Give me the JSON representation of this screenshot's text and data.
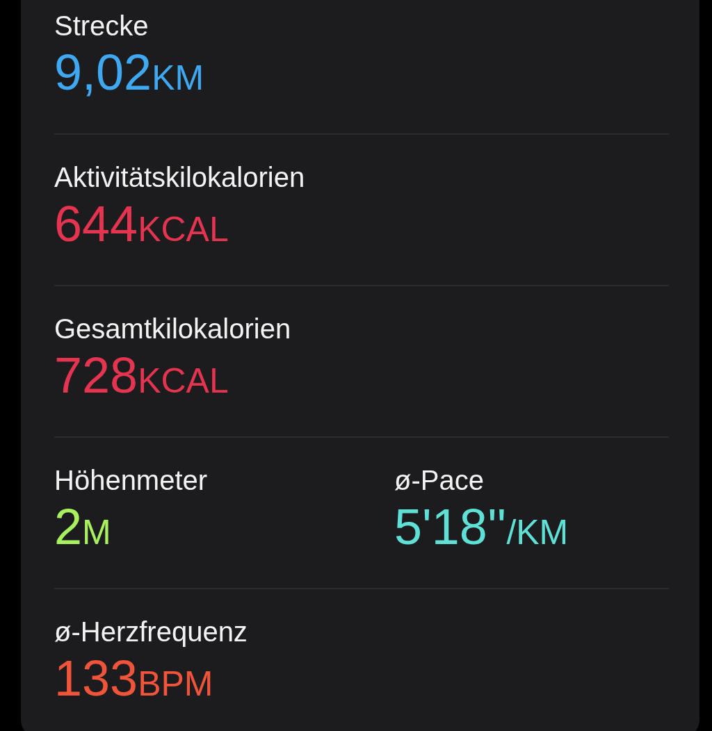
{
  "rows": [
    {
      "metrics": [
        {
          "label": "Strecke",
          "value": "9,02",
          "unit": "KM",
          "color": "#3fa8f2"
        }
      ]
    },
    {
      "metrics": [
        {
          "label": "Aktivitätskilokalorien",
          "value": "644",
          "unit": "KCAL",
          "color": "#e5344f"
        }
      ]
    },
    {
      "metrics": [
        {
          "label": "Gesamtkilokalorien",
          "value": "728",
          "unit": "KCAL",
          "color": "#e5344f"
        }
      ]
    },
    {
      "metrics": [
        {
          "label": "Höhenmeter",
          "value": "2",
          "unit": "M",
          "color": "#a8f05e"
        },
        {
          "label": "ø-Pace",
          "value": "5'18''",
          "unit": "/KM",
          "color": "#5fe0d6"
        }
      ]
    },
    {
      "metrics": [
        {
          "label": "ø-Herzfrequenz",
          "value": "133",
          "unit": "BPM",
          "color": "#f0543a"
        }
      ]
    }
  ]
}
